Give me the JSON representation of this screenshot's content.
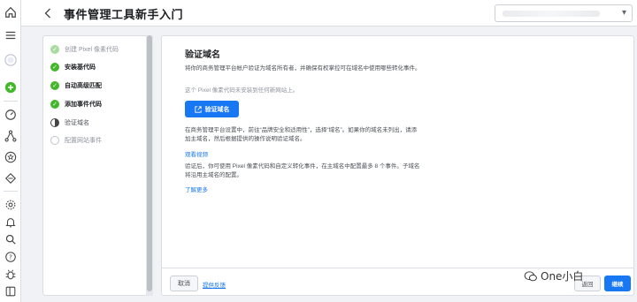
{
  "header": {
    "title": "事件管理工具新手入门",
    "account_select_value": ""
  },
  "steps": [
    {
      "label": "创建 Pixel 像素代码",
      "state": "done-light"
    },
    {
      "label": "安装基代码",
      "state": "done"
    },
    {
      "label": "自动高级匹配",
      "state": "done"
    },
    {
      "label": "添加事件代码",
      "state": "done"
    },
    {
      "label": "验证域名",
      "state": "current"
    },
    {
      "label": "配置网站事件",
      "state": "pending"
    }
  ],
  "main": {
    "title": "验证域名",
    "description": "将你的商务管理平台帐户验证为域名所有者，并确保有权掌控可在域名中使用哪些转化事件。",
    "note": "这个 Pixel 像素代码未安装到任何新网站上。",
    "verify_button": "验证域名",
    "para1_line1": "在商务管理平台设置中，前往“品牌安全和适用性”，选择“域名”。如果你的域名未列出，请添",
    "para1_line2": "加主域名，然后根据提供的操作说明验证域名。",
    "link_video": "观看视频",
    "para2_line1": "验证后，你可使用 Pixel 像素代码和自定义转化事件，在主域名中配置最多 8 个事件。子域名",
    "para2_line2": "将沿用主域名的配置。",
    "link_more": "了解更多"
  },
  "footer": {
    "cancel": "取消",
    "feedback": "提供反馈",
    "back": "返回",
    "next": "继续"
  },
  "watermark": "One小白",
  "colors": {
    "primary": "#1877f2",
    "success": "#42b72a"
  }
}
